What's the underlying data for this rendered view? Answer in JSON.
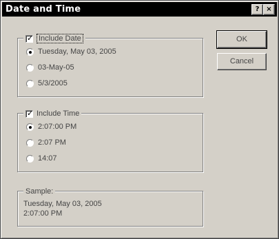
{
  "window": {
    "title": "Date and Time",
    "help_glyph": "?",
    "close_glyph": "×"
  },
  "date_group": {
    "label": "Include Date",
    "checked": true,
    "options": [
      "Tuesday, May 03, 2005",
      "03-May-05",
      "5/3/2005"
    ],
    "selected_index": 0
  },
  "time_group": {
    "label": "Include Time",
    "checked": true,
    "options": [
      "2:07:00 PM",
      "2:07 PM",
      "14:07"
    ],
    "selected_index": 0
  },
  "sample": {
    "label": "Sample:",
    "line1": "Tuesday, May 03, 2005",
    "line2": "2:07:00 PM"
  },
  "buttons": {
    "ok": "OK",
    "cancel": "Cancel"
  },
  "check_glyph": "✓"
}
